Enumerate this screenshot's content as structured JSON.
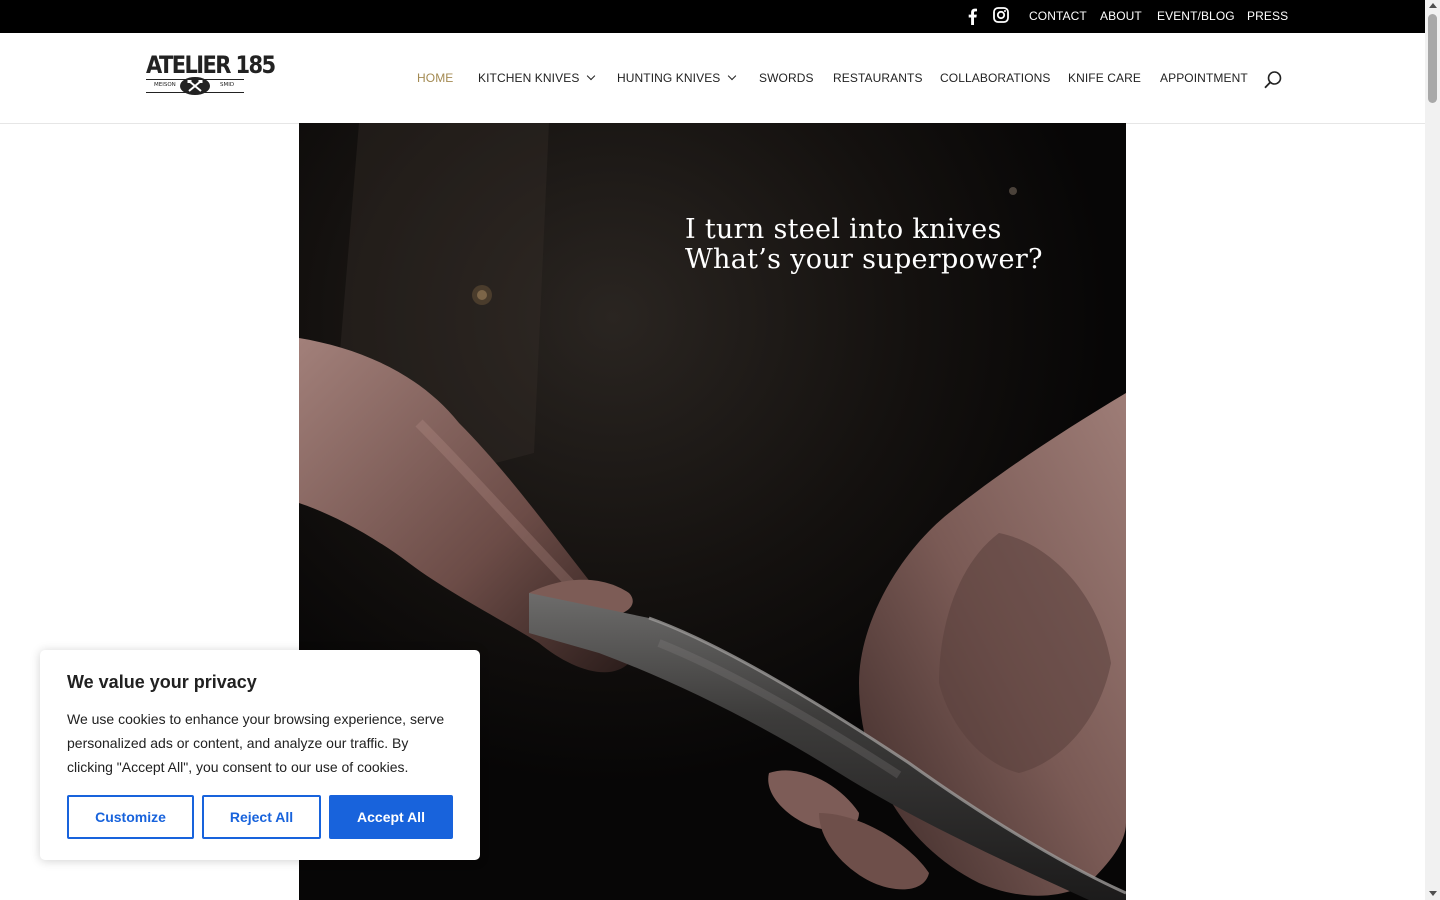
{
  "topbar": {
    "social": [
      "facebook-icon",
      "instagram-icon"
    ],
    "links": [
      "CONTACT",
      "ABOUT",
      "EVENT/BLOG",
      "PRESS"
    ]
  },
  "logo": {
    "name": "ATELIER 185",
    "left_sub": "MEISON",
    "right_sub": "SMID"
  },
  "nav": {
    "items": [
      {
        "label": "HOME",
        "active": true
      },
      {
        "label": "KITCHEN KNIVES",
        "has_dropdown": true
      },
      {
        "label": "HUNTING KNIVES",
        "has_dropdown": true
      },
      {
        "label": "SWORDS"
      },
      {
        "label": "RESTAURANTS"
      },
      {
        "label": "COLLABORATIONS"
      },
      {
        "label": "KNIFE CARE"
      },
      {
        "label": "APPOINTMENT"
      }
    ],
    "search_icon": "search-icon",
    "active_color": "#a38a52"
  },
  "hero": {
    "line1": "I turn steel into knives",
    "line2": "What’s your superpower?"
  },
  "cookie": {
    "title": "We value your privacy",
    "body": "We use cookies to enhance your browsing experience, serve personalized ads or content, and analyze our traffic. By clicking \"Accept All\", you consent to our use of cookies.",
    "customize": "Customize",
    "reject": "Reject All",
    "accept": "Accept All",
    "accent": "#1863dc"
  }
}
